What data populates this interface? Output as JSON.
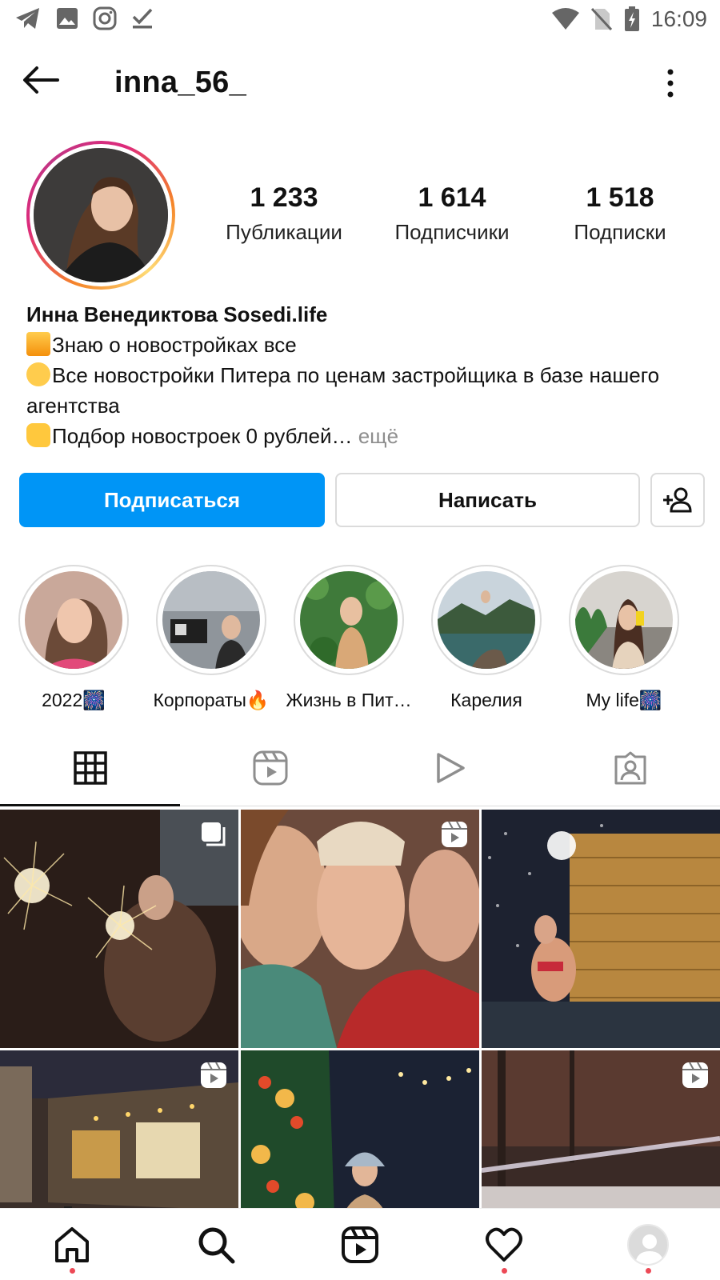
{
  "status_bar": {
    "time": "16:09",
    "icons_left": [
      "telegram-icon",
      "gallery-icon",
      "instagram-icon",
      "checkmark-icon"
    ],
    "icons_right": [
      "wifi-icon",
      "no-sim-icon",
      "battery-charging-icon"
    ]
  },
  "header": {
    "username": "inna_56_"
  },
  "profile": {
    "stats": [
      {
        "value": "1 233",
        "label": "Публикации"
      },
      {
        "value": "1 614",
        "label": "Подписчики"
      },
      {
        "value": "1 518",
        "label": "Подписки"
      }
    ],
    "name": "Инна Венедиктова Sosedi.life",
    "bio_line1": "Знаю о новостройках все",
    "bio_line2": "Все новостройки Питера по ценам застройщика в базе нашего агентства",
    "bio_line3": "Подбор новостроек 0 рублей…",
    "more": " ещё"
  },
  "buttons": {
    "follow": "Подписаться",
    "message": "Написать"
  },
  "highlights": [
    {
      "label": "2022🎆"
    },
    {
      "label": "Корпораты🔥"
    },
    {
      "label": "Жизнь в Пит…"
    },
    {
      "label": "Карелия"
    },
    {
      "label": "My life🎆"
    }
  ],
  "tabs": [
    "grid-tab",
    "reels-tab",
    "videos-tab",
    "tagged-tab"
  ],
  "grid_badges": [
    "carousel-icon",
    "reels-icon",
    "",
    "reels-icon",
    "",
    "reels-icon"
  ],
  "colors": {
    "accent": "#0095f6",
    "notification_dot": "#ed4956",
    "border": "#dbdbdb"
  }
}
